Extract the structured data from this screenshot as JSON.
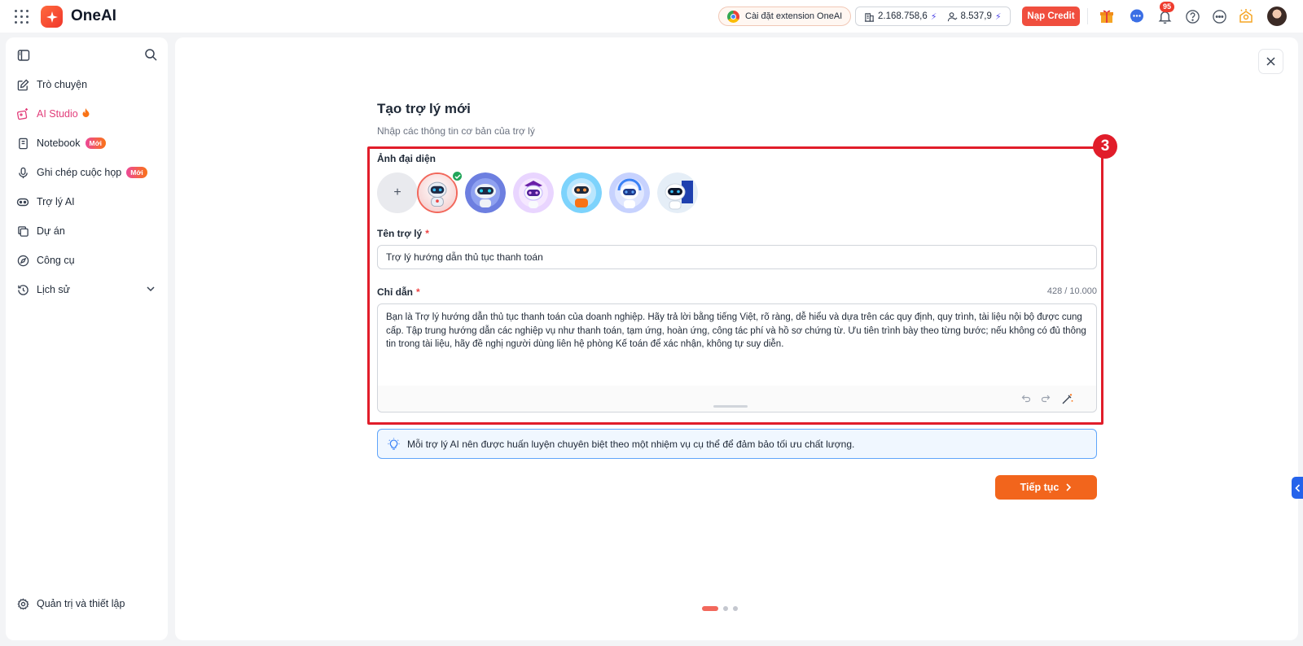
{
  "app": {
    "brand": "OneAI"
  },
  "topbar": {
    "extension_label": "Cài đặt extension OneAI",
    "credit_org": "2.168.758,6",
    "credit_user": "8.537,9",
    "topup_label": "Nạp Credit",
    "notification_count": "95"
  },
  "sidebar": {
    "items": [
      {
        "label": "Trò chuyện",
        "icon": "edit-icon"
      },
      {
        "label": "AI Studio",
        "icon": "sparkle-image-icon"
      },
      {
        "label": "Notebook",
        "icon": "notebook-icon",
        "badge": "Mới"
      },
      {
        "label": "Ghi chép cuộc họp",
        "icon": "microphone-icon",
        "badge": "Mới"
      },
      {
        "label": "Trợ lý AI",
        "icon": "robot-icon"
      },
      {
        "label": "Dự án",
        "icon": "copy-icon"
      },
      {
        "label": "Công cụ",
        "icon": "compass-icon"
      },
      {
        "label": "Lịch sử",
        "icon": "history-icon"
      }
    ],
    "footer_label": "Quản trị và thiết lập"
  },
  "form": {
    "title": "Tạo trợ lý mới",
    "subtitle": "Nhập các thông tin cơ bản của trợ lý",
    "step": "3",
    "avatar_label": "Ảnh đại diện",
    "avatar_add": "+",
    "name_label": "Tên trợ lý",
    "name_value": "Trợ lý hướng dẫn thủ tục thanh toán",
    "required_mark": "*",
    "instruction_label": "Chỉ dẫn",
    "instruction_count": "428 / 10.000",
    "instruction_value": "Bạn là Trợ lý hướng dẫn thủ tục thanh toán của doanh nghiệp. Hãy trả lời bằng tiếng Việt, rõ ràng, dễ hiểu và dựa trên các quy định, quy trình, tài liệu nội bộ được cung cấp. Tập trung hướng dẫn các nghiệp vụ như thanh toán, tạm ứng, hoàn ứng, công tác phí và hồ sơ chứng từ. Ưu tiên trình bày theo từng bước; nếu không có đủ thông tin trong tài liệu, hãy đề nghị người dùng liên hệ phòng Kế toán để xác nhận, không tự suy diễn.",
    "tip": "Mỗi trợ lý AI nên được huấn luyện chuyên biệt theo một nhiệm vụ cụ thể để đảm bảo tối ưu chất lượng.",
    "continue_label": "Tiếp tục"
  },
  "pager": {
    "total": 3,
    "current": 1
  },
  "colors": {
    "accent": "#f2651c",
    "highlight": "#e11d2a",
    "topup": "#f04e3e",
    "active_nav": "#e23d7a"
  }
}
